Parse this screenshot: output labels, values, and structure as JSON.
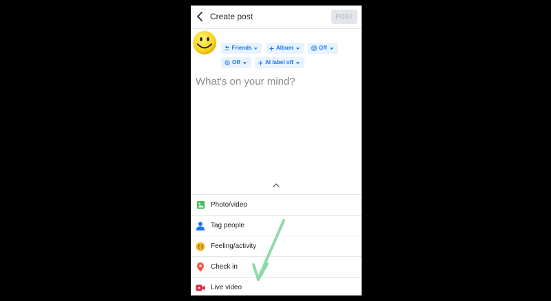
{
  "header": {
    "title": "Create post",
    "post_label": "POST"
  },
  "audience_chips": [
    {
      "label": "Friends",
      "icon": "friends-icon"
    },
    {
      "label": "Album",
      "icon": "plus-icon"
    },
    {
      "label": "Off",
      "icon": "instagram-icon"
    },
    {
      "label": "Off",
      "icon": "threads-icon"
    },
    {
      "label": "AI label off",
      "icon": "plus-icon"
    }
  ],
  "composer": {
    "placeholder": "What's on your mind?"
  },
  "actions": [
    {
      "label": "Photo/video",
      "icon": "photo-icon",
      "color": "#45bd62"
    },
    {
      "label": "Tag people",
      "icon": "tag-people-icon",
      "color": "#1877f2"
    },
    {
      "label": "Feeling/activity",
      "icon": "feeling-icon",
      "color": "#f7b928"
    },
    {
      "label": "Check in",
      "icon": "location-pin-icon",
      "color": "#f5533d"
    },
    {
      "label": "Live video",
      "icon": "live-video-icon",
      "color": "#e42645"
    }
  ],
  "colors": {
    "accent": "#1877f2",
    "chip_bg": "#e7f3ff",
    "annotation_arrow": "#8fd9a8"
  }
}
